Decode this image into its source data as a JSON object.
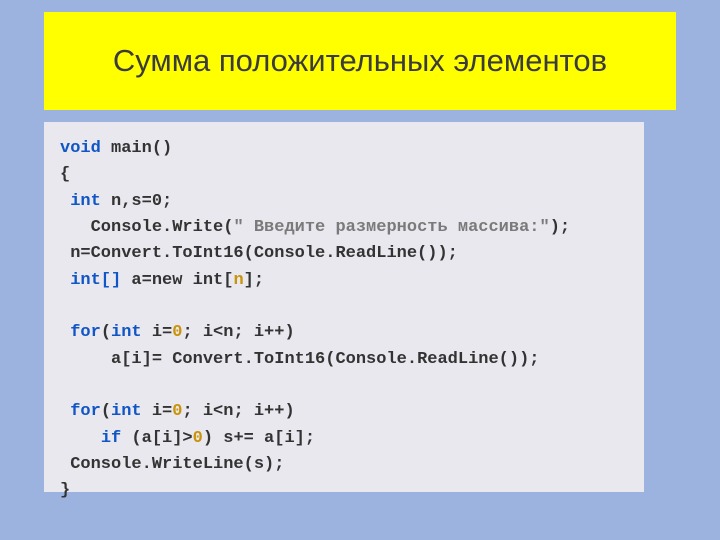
{
  "title": "Сумма положительных элементов",
  "code": {
    "l1": {
      "kw1": "void",
      "t1": " main()"
    },
    "l2": {
      "t1": "{"
    },
    "l3": {
      "sp": " ",
      "kw1": "int",
      "t1": " n,s=0;"
    },
    "l4": {
      "sp": "   ",
      "t1": "Console.Write(",
      "str": "\" Введите размерность массива:\"",
      "t2": ");"
    },
    "l5": {
      "sp": " ",
      "t1": "n=Convert.ToInt16(Console.ReadLine());"
    },
    "l6": {
      "sp": " ",
      "kw1": "int[]",
      "t1": " a=new int[",
      "v1": "n",
      "t2": "];"
    },
    "l8": {
      "sp": " ",
      "kw1": "for",
      "t1": "(",
      "kw2": "int",
      "t2": " i=",
      "n1": "0",
      "t3": "; i<n; i++)"
    },
    "l9": {
      "sp": "     ",
      "t1": "a[i]= Convert.ToInt16(Console.ReadLine());"
    },
    "l11": {
      "sp": " ",
      "kw1": "for",
      "t1": "(",
      "kw2": "int",
      "t2": " i=",
      "n1": "0",
      "t3": "; i<n; i++)"
    },
    "l12": {
      "sp": "    ",
      "kw1": "if ",
      "t1": "(a[i]>",
      "n1": "0",
      "t2": ") s+= a[i];"
    },
    "l13": {
      "sp": " ",
      "t1": "Console.WriteLine(s);"
    },
    "l14": {
      "t1": "}"
    }
  }
}
